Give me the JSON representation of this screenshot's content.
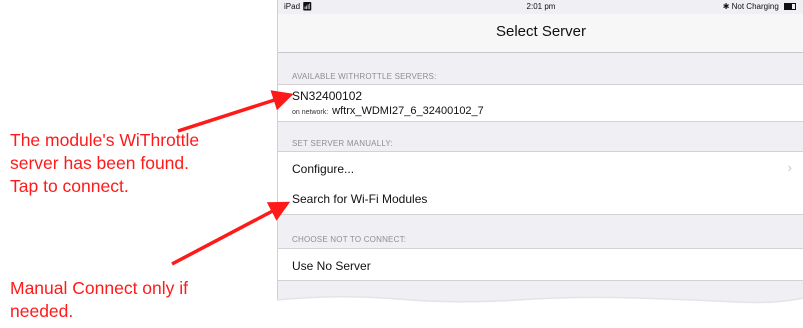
{
  "status_bar": {
    "device": "iPad",
    "time": "2:01 pm",
    "charging": "Not Charging"
  },
  "nav": {
    "title": "Select Server"
  },
  "sections": {
    "available": {
      "header": "AVAILABLE WITHROTTLE SERVERS:",
      "server_name": "SN32400102",
      "network_prefix": "on network:",
      "network_name": "wftrx_WDMI27_6_32400102_7"
    },
    "manual": {
      "header": "SET SERVER MANUALLY:",
      "configure": "Configure...",
      "search": "Search for Wi-Fi Modules"
    },
    "none": {
      "header": "CHOOSE NOT TO CONNECT:",
      "use_no_server": "Use No Server"
    }
  },
  "annotations": {
    "found_lines": [
      "The module's WiThrottle",
      "server has been found.",
      "Tap to connect."
    ],
    "manual_lines": [
      "Manual Connect only if",
      "needed."
    ],
    "color": "#ff1a1a"
  },
  "icons": {
    "wifi": "wifi-icon",
    "bluetooth": "bluetooth-icon",
    "battery": "battery-icon",
    "chevron": "chevron-right-icon"
  }
}
